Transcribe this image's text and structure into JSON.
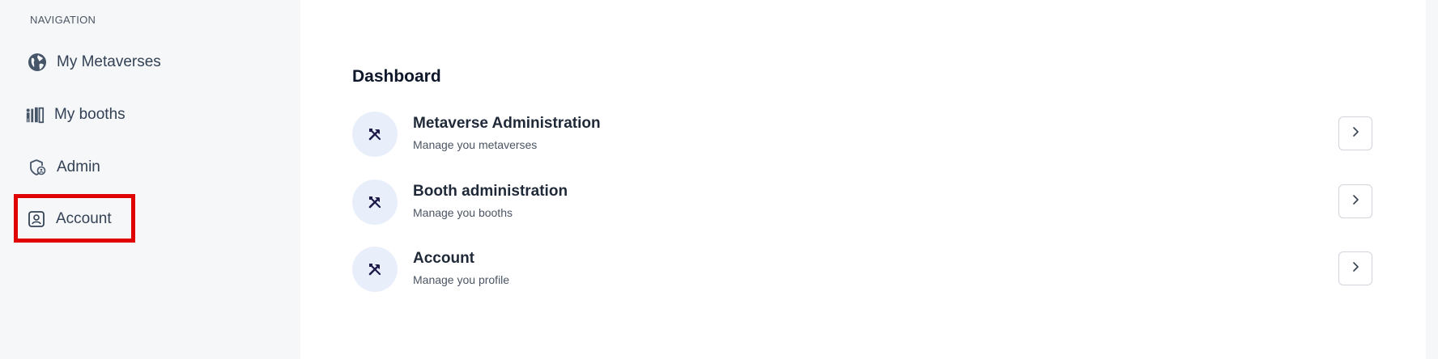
{
  "sidebar": {
    "heading": "NAVIGATION",
    "items": [
      {
        "label": "My Metaverses",
        "icon": "globe-icon"
      },
      {
        "label": "My booths",
        "icon": "booth-icon"
      },
      {
        "label": "Admin",
        "icon": "shield-icon"
      },
      {
        "label": "Account",
        "icon": "account-icon",
        "highlighted": true
      }
    ]
  },
  "main": {
    "title": "Dashboard",
    "rows": [
      {
        "title": "Metaverse Administration",
        "subtitle": "Manage you metaverses",
        "icon": "tools-icon"
      },
      {
        "title": "Booth administration",
        "subtitle": "Manage you booths",
        "icon": "tools-icon"
      },
      {
        "title": "Account",
        "subtitle": "Manage you profile",
        "icon": "tools-icon"
      }
    ]
  },
  "colors": {
    "sidebar_bg": "#f6f7f9",
    "highlight": "#e00000",
    "badge_bg": "#e8effb",
    "icon_dark": "#1e1b4b"
  }
}
